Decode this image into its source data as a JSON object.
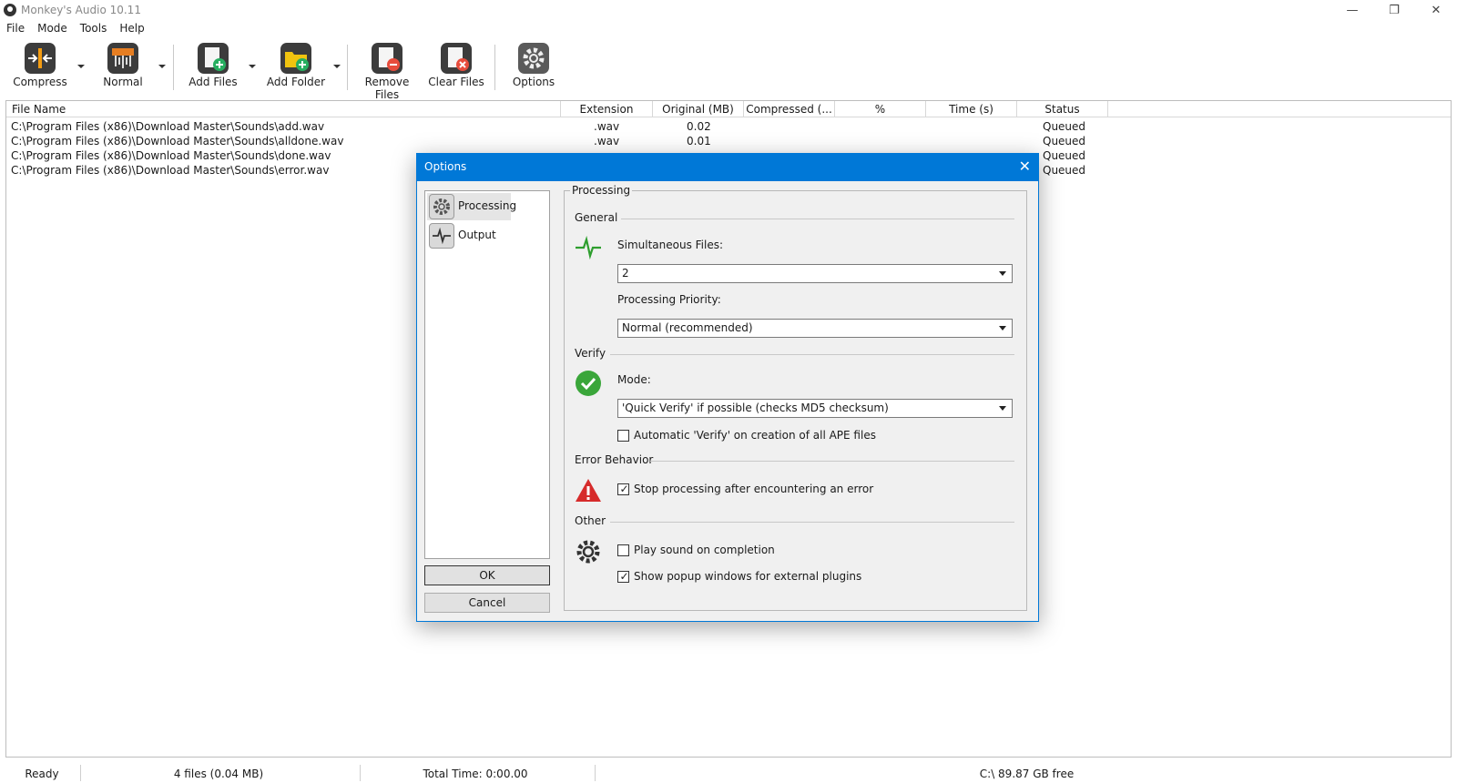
{
  "window": {
    "title": "Monkey's Audio 10.11",
    "controls": {
      "minimize": "—",
      "maximize": "❐",
      "close": "✕"
    }
  },
  "menu": [
    "File",
    "Mode",
    "Tools",
    "Help"
  ],
  "toolbar": {
    "compress": "Compress",
    "normal": "Normal",
    "add_files": "Add Files",
    "add_folder": "Add Folder",
    "remove_files": "Remove Files",
    "clear_files": "Clear Files",
    "options": "Options"
  },
  "file_list": {
    "columns": [
      "File Name",
      "Extension",
      "Original (MB)",
      "Compressed (...",
      "%",
      "Time (s)",
      "Status"
    ],
    "rows": [
      {
        "name": "C:\\Program Files (x86)\\Download Master\\Sounds\\add.wav",
        "ext": ".wav",
        "orig": "0.02",
        "status": "Queued"
      },
      {
        "name": "C:\\Program Files (x86)\\Download Master\\Sounds\\alldone.wav",
        "ext": ".wav",
        "orig": "0.01",
        "status": "Queued"
      },
      {
        "name": "C:\\Program Files (x86)\\Download Master\\Sounds\\done.wav",
        "ext": "",
        "orig": "",
        "status": "Queued"
      },
      {
        "name": "C:\\Program Files (x86)\\Download Master\\Sounds\\error.wav",
        "ext": "",
        "orig": "",
        "status": "Queued"
      }
    ]
  },
  "statusbar": {
    "state": "Ready",
    "files": "4 files (0.04 MB)",
    "total_time": "Total Time: 0:00.00",
    "disk": "C:\\ 89.87 GB free"
  },
  "dialog": {
    "title": "Options",
    "close": "✕",
    "nav": [
      "Processing",
      "Output"
    ],
    "ok": "OK",
    "cancel": "Cancel",
    "panel_title": "Processing",
    "general": {
      "label": "General",
      "simultaneous_label": "Simultaneous Files:",
      "simultaneous_value": "2",
      "priority_label": "Processing Priority:",
      "priority_value": "Normal (recommended)"
    },
    "verify": {
      "label": "Verify",
      "mode_label": "Mode:",
      "mode_value": "'Quick Verify' if possible (checks MD5 checksum)",
      "auto_verify": "Automatic 'Verify' on creation of all APE files",
      "auto_verify_checked": false
    },
    "error_behavior": {
      "label": "Error Behavior",
      "stop_processing": "Stop processing after encountering an error",
      "stop_processing_checked": true
    },
    "other": {
      "label": "Other",
      "play_sound": "Play sound on completion",
      "play_sound_checked": false,
      "show_popup": "Show popup windows for external plugins",
      "show_popup_checked": true
    },
    "check_glyph": "✓"
  }
}
